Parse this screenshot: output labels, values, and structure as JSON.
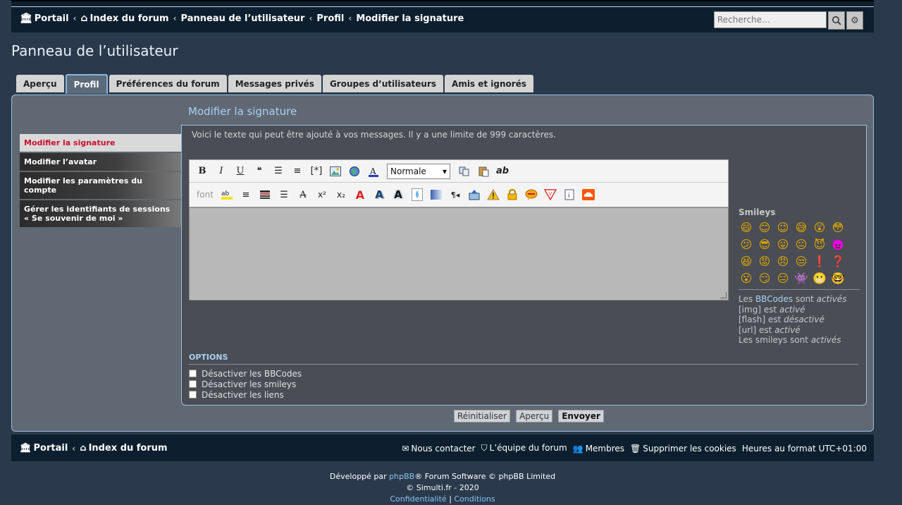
{
  "breadcrumbs": [
    "Portail",
    "Index du forum",
    "Panneau de l’utilisateur",
    "Profil",
    "Modifier la signature"
  ],
  "search": {
    "placeholder": "Recherche…"
  },
  "page_title": "Panneau de l’utilisateur",
  "tabs": [
    "Aperçu",
    "Profil",
    "Préférences du forum",
    "Messages privés",
    "Groupes d’utilisateurs",
    "Amis et ignorés"
  ],
  "active_tab": "Profil",
  "section_title": "Modifier la signature",
  "sidemenu": [
    "Modifier la signature",
    "Modifier l’avatar",
    "Modifier les paramètres du compte",
    "Gérer les identifiants de sessions",
    "« Se souvenir de moi »"
  ],
  "intro": "Voici le texte qui peut être ajouté à vos messages. Il y a une limite de 999 caractères.",
  "editor": {
    "bold": "B",
    "italic": "I",
    "underline": "U",
    "list_item": "[*]",
    "font_label": "font",
    "size_value": "Normale",
    "strike_ab": "ab"
  },
  "smileys": {
    "title": "Smileys"
  },
  "bbinfo": {
    "line1_pre": "Les ",
    "bbcodes": "BBCodes",
    "line1_mid": " sont ",
    "line1_state": "activés",
    "img": "[img] est ",
    "img_state": "activé",
    "flash": "[flash] est ",
    "flash_state": "désactivé",
    "url": "[url] est ",
    "url_state": "activé",
    "smileys_pre": "Les smileys sont ",
    "smileys_state": "activés"
  },
  "options": {
    "title": "OPTIONS",
    "items": [
      "Désactiver les BBCodes",
      "Désactiver les smileys",
      "Désactiver les liens"
    ]
  },
  "buttons": {
    "reset": "Réinitialiser",
    "preview": "Aperçu",
    "submit": "Envoyer"
  },
  "footer": {
    "crumbs": [
      "Portail",
      "Index du forum"
    ],
    "contact": "Nous contacter",
    "team": "L’équipe du forum",
    "members": "Membres",
    "cookies": "Supprimer les cookies",
    "timezone": "Heures au format UTC+01:00"
  },
  "copyright": {
    "dev_pre": "Développé par ",
    "phpbb": "phpBB",
    "dev_post": "® Forum Software © phpBB Limited",
    "site": "© Simulti.fr - 2020",
    "privacy": "Confidentialité",
    "sep": " | ",
    "terms": "Conditions"
  },
  "colors": {
    "accent": "#a9d1f2",
    "active_menu": "#c8102e",
    "header_bg": "#0d1f2e",
    "panel_bg": "#606873"
  }
}
